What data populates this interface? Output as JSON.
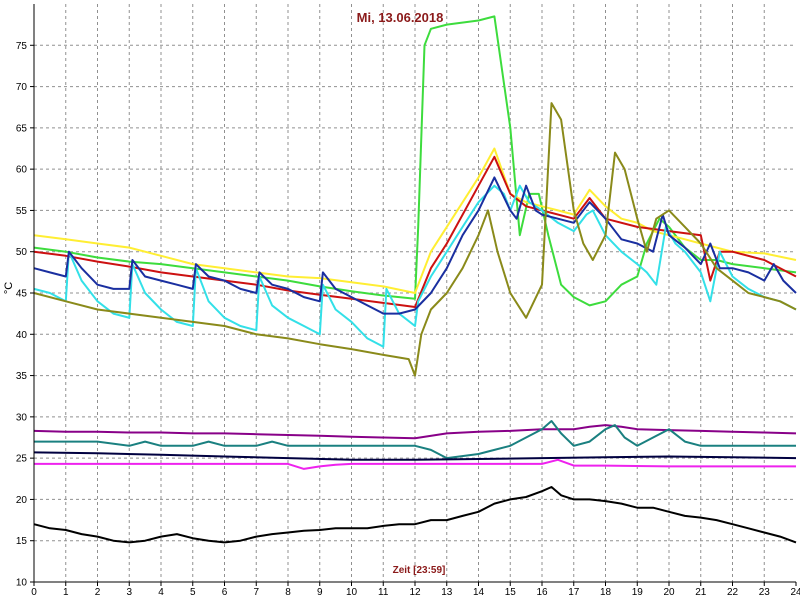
{
  "chart_data": {
    "type": "line",
    "title": "Mi, 13.06.2018",
    "xlabel": "Zeit [23:59]",
    "ylabel": "°C",
    "xlim": [
      0,
      24
    ],
    "ylim": [
      10,
      80
    ],
    "xticks": [
      "0",
      "1",
      "2",
      "3",
      "4",
      "5",
      "6",
      "7",
      "8",
      "9",
      "10",
      "11",
      "12",
      "13",
      "14",
      "15",
      "16",
      "17",
      "18",
      "19",
      "20",
      "21",
      "22",
      "23",
      "24"
    ],
    "yticks": [
      "10",
      "15",
      "20",
      "25",
      "30",
      "35",
      "40",
      "45",
      "50",
      "55",
      "60",
      "65",
      "70",
      "75"
    ],
    "grid": true,
    "colors": {
      "title": "#8b1a1a",
      "xlabel": "#8b1a1a",
      "grid": "#909090",
      "axis": "#000000"
    },
    "series": [
      {
        "color": "#3ddc3d",
        "x": [
          0,
          1,
          2,
          3,
          4,
          5,
          6,
          7,
          8,
          9,
          10,
          11,
          12,
          12.1,
          12.3,
          12.5,
          13,
          14,
          14.5,
          15,
          15.3,
          15.6,
          15.9,
          16.2,
          16.6,
          17,
          17.5,
          18,
          18.5,
          19,
          19.3,
          19.7,
          20,
          20.5,
          21,
          21.5,
          22,
          23,
          24
        ],
        "y": [
          50.5,
          50,
          49.3,
          48.8,
          48.5,
          48,
          47.5,
          47,
          46.5,
          45.8,
          45.2,
          44.7,
          44.3,
          53,
          75,
          77,
          77.5,
          78,
          78.5,
          65,
          52,
          57,
          57,
          52,
          46,
          44.5,
          43.5,
          44,
          46,
          47,
          51,
          54,
          53,
          50.5,
          49,
          49,
          48.5,
          48,
          47.5
        ]
      },
      {
        "color": "#ffee33",
        "x": [
          0,
          1,
          2,
          3,
          4,
          5,
          6,
          7,
          8,
          9,
          10,
          11,
          12,
          12.5,
          13,
          14,
          14.5,
          15,
          15.5,
          16,
          16.5,
          17,
          17.5,
          18,
          18.5,
          19,
          19.5,
          20,
          20.5,
          21,
          21.5,
          22,
          23,
          24
        ],
        "y": [
          52,
          51.5,
          51,
          50.5,
          49.5,
          48.5,
          48,
          47.5,
          47,
          46.8,
          46.3,
          45.8,
          45,
          50,
          53,
          59,
          62.5,
          57,
          56,
          55.5,
          55,
          54.5,
          57.5,
          55.5,
          54,
          53.5,
          52.5,
          52,
          51.5,
          51,
          50.5,
          50,
          49.8,
          49
        ]
      },
      {
        "color": "#cc1111",
        "x": [
          0,
          1,
          2,
          3,
          4,
          5,
          6,
          7,
          8,
          9,
          10,
          11,
          12,
          12.5,
          13,
          14,
          14.5,
          15,
          15.5,
          16,
          17,
          17.5,
          18,
          19,
          20,
          21,
          21.3,
          21.6,
          22,
          23,
          24
        ],
        "y": [
          50,
          49.5,
          48.8,
          48.2,
          47.5,
          47,
          46.5,
          46,
          45.3,
          44.8,
          44.3,
          43.8,
          43.3,
          48,
          51,
          58,
          61.5,
          57,
          55.5,
          55,
          54,
          56.5,
          54,
          53,
          52.5,
          52,
          46.5,
          50,
          50,
          49,
          47
        ]
      },
      {
        "color": "#33e0e8",
        "x": [
          0,
          0.5,
          1,
          1.1,
          1.5,
          2,
          2.5,
          3,
          3.1,
          3.5,
          4,
          4.5,
          5,
          5.1,
          5.5,
          6,
          6.5,
          7,
          7.1,
          7.5,
          8,
          8.5,
          9,
          9.1,
          9.5,
          10,
          10.5,
          11,
          11.1,
          11.5,
          12,
          12.1,
          12.5,
          13,
          13.5,
          14,
          14.5,
          14.8,
          15,
          15.3,
          15.6,
          16,
          16.5,
          17,
          17.4,
          17.6,
          18,
          18.5,
          19,
          19.3,
          19.6,
          19.9,
          20.2,
          20.5,
          21,
          21.3,
          21.6,
          22,
          22.5,
          23,
          23.5,
          24
        ],
        "y": [
          45.5,
          45,
          44,
          50,
          46.5,
          44,
          42.5,
          42,
          48.5,
          45,
          43,
          41.5,
          41,
          48,
          44,
          42,
          41,
          40.5,
          47,
          43.5,
          42,
          41,
          40,
          46,
          43,
          41.5,
          39.5,
          38.5,
          45.5,
          42.5,
          41,
          44,
          47,
          50,
          53,
          56,
          58,
          57,
          55,
          58,
          56,
          55,
          53.5,
          52.5,
          54.5,
          55,
          52,
          50,
          48.5,
          47.5,
          46,
          53,
          51,
          50,
          47.5,
          44,
          50,
          47,
          45.5,
          44.5,
          44,
          43
        ]
      },
      {
        "color": "#1a2fa0",
        "x": [
          0,
          0.5,
          1,
          1.1,
          1.5,
          2,
          2.5,
          3,
          3.1,
          3.5,
          4,
          4.5,
          5,
          5.1,
          5.5,
          6,
          6.5,
          7,
          7.1,
          7.5,
          8,
          8.5,
          9,
          9.1,
          9.5,
          10,
          10.5,
          11,
          11.5,
          12,
          12.5,
          13,
          13.5,
          14,
          14.5,
          15,
          15.2,
          15.5,
          15.8,
          16,
          16.5,
          17,
          17.5,
          18,
          18.5,
          19,
          19.5,
          19.8,
          20,
          20.5,
          21,
          21.3,
          21.6,
          22,
          22.5,
          23,
          23.3,
          23.6,
          24
        ],
        "y": [
          48,
          47.5,
          47,
          50,
          48,
          46,
          45.5,
          45.5,
          49,
          47,
          46.5,
          46,
          45.5,
          48.5,
          47,
          46.5,
          45.5,
          45,
          47.5,
          46,
          45.5,
          44.5,
          44,
          47.5,
          45.5,
          44.5,
          43.5,
          42.5,
          42.5,
          43,
          45,
          48,
          52,
          55,
          59,
          55,
          54,
          58,
          55,
          54.5,
          54,
          53.5,
          56,
          54,
          51.5,
          51,
          50,
          54.5,
          52,
          50.5,
          48.5,
          51,
          48,
          48,
          47.5,
          46.5,
          48.5,
          46.5,
          45
        ]
      },
      {
        "color": "#8a8a1a",
        "x": [
          0,
          1,
          2,
          3,
          4,
          5,
          6,
          7,
          8,
          9,
          10,
          11,
          11.8,
          12,
          12.2,
          12.5,
          13,
          13.5,
          14,
          14.3,
          14.6,
          15,
          15.5,
          16,
          16.3,
          16.6,
          17,
          17.3,
          17.6,
          18,
          18.3,
          18.6,
          19,
          19.3,
          19.6,
          20,
          20.5,
          21,
          21.5,
          22,
          22.5,
          23,
          23.5,
          24
        ],
        "y": [
          45,
          44,
          43,
          42.5,
          42,
          41.5,
          41,
          40,
          39.5,
          38.8,
          38.2,
          37.5,
          37,
          35,
          40,
          43,
          45,
          48,
          52,
          55,
          50,
          45,
          42,
          46,
          68,
          66,
          55,
          51,
          49,
          52,
          62,
          60,
          54,
          50,
          54,
          55,
          53,
          51,
          48,
          46.5,
          45,
          44.5,
          44,
          43
        ]
      },
      {
        "color": "#880088",
        "x": [
          0,
          1,
          2,
          3,
          4,
          5,
          6,
          7,
          8,
          9,
          10,
          11,
          12,
          13,
          14,
          15,
          16,
          17,
          17.5,
          18,
          18.5,
          19,
          20,
          21,
          22,
          23,
          24
        ],
        "y": [
          28.3,
          28.2,
          28.2,
          28.1,
          28.1,
          28,
          28,
          27.9,
          27.8,
          27.7,
          27.6,
          27.5,
          27.4,
          28,
          28.2,
          28.3,
          28.5,
          28.5,
          28.8,
          29,
          28.8,
          28.5,
          28.4,
          28.3,
          28.2,
          28.1,
          28
        ]
      },
      {
        "color": "#1a8080",
        "x": [
          0,
          1,
          2,
          3,
          3.5,
          4,
          5,
          5.5,
          6,
          7,
          7.5,
          8,
          9,
          10,
          11,
          12,
          12.5,
          13,
          14,
          14.5,
          15,
          15.5,
          16,
          16.3,
          16.6,
          17,
          17.5,
          18,
          18.3,
          18.6,
          19,
          19.5,
          20,
          20.5,
          21,
          22,
          23,
          24
        ],
        "y": [
          27,
          27,
          27,
          26.5,
          27,
          26.5,
          26.5,
          27,
          26.5,
          26.5,
          27,
          26.5,
          26.5,
          26.5,
          26.5,
          26.5,
          26,
          25,
          25.5,
          26,
          26.5,
          27.5,
          28.5,
          29.5,
          28,
          26.5,
          27,
          28.5,
          29,
          27.5,
          26.5,
          27.5,
          28.5,
          27,
          26.5,
          26.5,
          26.5,
          26.5
        ]
      },
      {
        "color": "#000040",
        "x": [
          0,
          2,
          4,
          6,
          8,
          10,
          12,
          14,
          16,
          18,
          20,
          22,
          24
        ],
        "y": [
          25.7,
          25.6,
          25.4,
          25.2,
          25,
          24.8,
          24.8,
          24.9,
          25,
          25.1,
          25.2,
          25.1,
          25
        ]
      },
      {
        "color": "#ee22ee",
        "x": [
          0,
          2,
          4,
          6,
          8,
          8.5,
          9,
          9.5,
          10,
          12,
          14,
          16,
          16.5,
          17,
          18,
          20,
          22,
          24
        ],
        "y": [
          24.3,
          24.3,
          24.3,
          24.3,
          24.3,
          23.7,
          24,
          24.2,
          24.3,
          24.3,
          24.3,
          24.3,
          24.8,
          24.1,
          24.1,
          24,
          24,
          24
        ]
      },
      {
        "color": "#000000",
        "x": [
          0,
          0.5,
          1,
          1.5,
          2,
          2.5,
          3,
          3.5,
          4,
          4.5,
          5,
          5.5,
          6,
          6.5,
          7,
          7.5,
          8,
          8.5,
          9,
          9.5,
          10,
          10.5,
          11,
          11.5,
          12,
          12.5,
          13,
          13.5,
          14,
          14.5,
          15,
          15.5,
          16,
          16.3,
          16.6,
          17,
          17.5,
          18,
          18.5,
          19,
          19.5,
          20,
          20.5,
          21,
          21.5,
          22,
          22.5,
          23,
          23.5,
          24
        ],
        "y": [
          17,
          16.5,
          16.3,
          15.8,
          15.5,
          15,
          14.8,
          15,
          15.5,
          15.8,
          15.3,
          15,
          14.8,
          15,
          15.5,
          15.8,
          16,
          16.2,
          16.3,
          16.5,
          16.5,
          16.5,
          16.8,
          17,
          17,
          17.5,
          17.5,
          18,
          18.5,
          19.5,
          20,
          20.3,
          21,
          21.5,
          20.5,
          20,
          20,
          19.8,
          19.5,
          19,
          19,
          18.5,
          18,
          17.8,
          17.5,
          17,
          16.5,
          16,
          15.5,
          14.8
        ]
      }
    ]
  }
}
